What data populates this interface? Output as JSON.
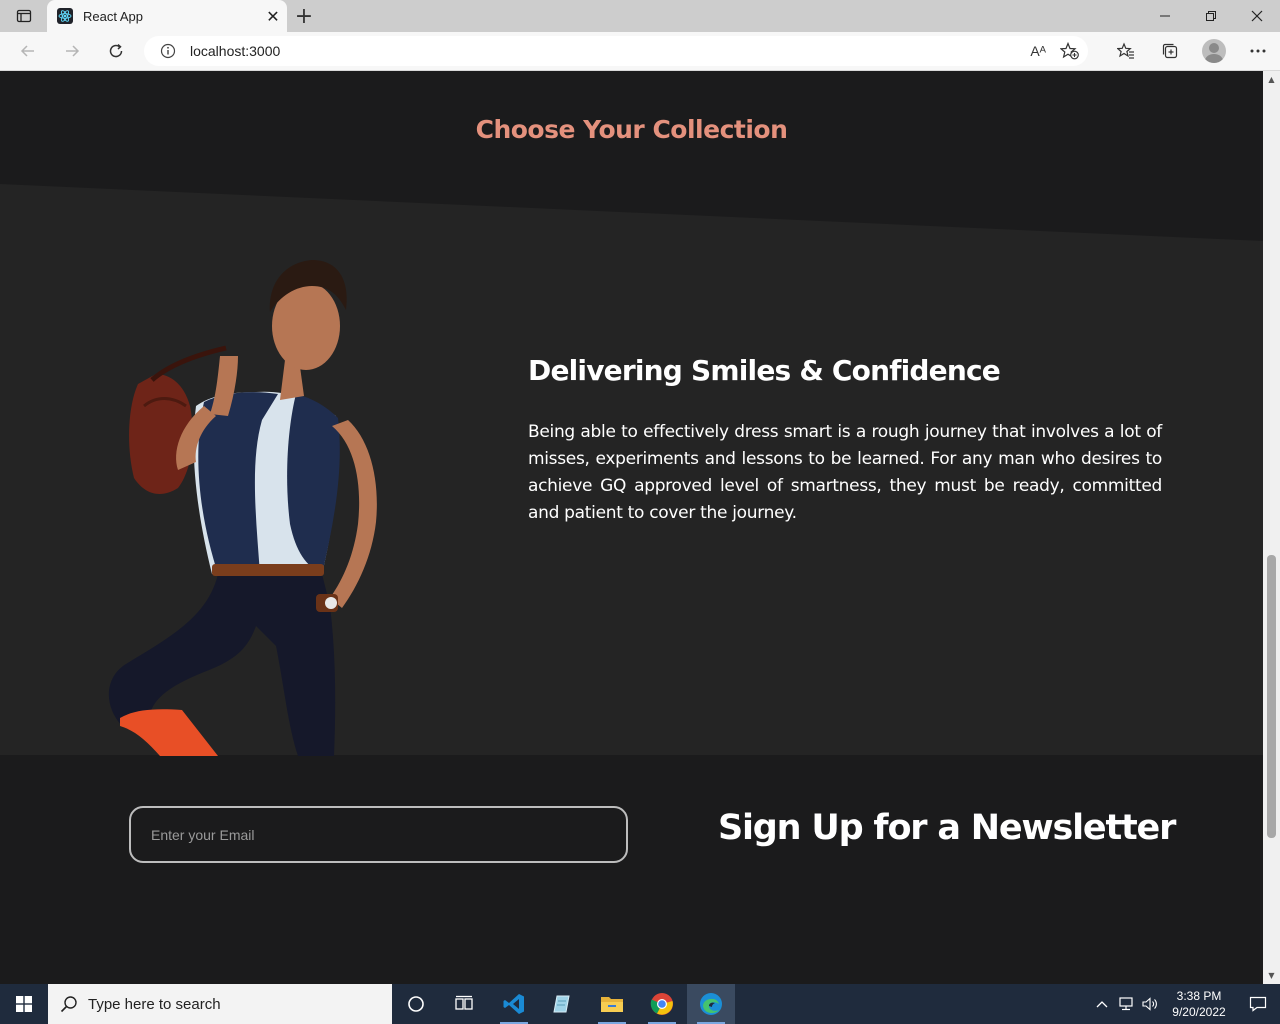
{
  "browser": {
    "tab_title": "React App",
    "url": "localhost:3000",
    "read_aloud_label": "Aᴬ"
  },
  "page": {
    "collection_heading": "Choose Your Collection",
    "feature": {
      "title": "Delivering Smiles & Confidence",
      "body": "Being able to effectively dress smart is a rough journey that involves a lot of misses, experiments and lessons to be learned. For any man who desires to achieve GQ approved level of smartness, they must be ready, committed and patient to cover the journey."
    },
    "newsletter": {
      "placeholder": "Enter your Email",
      "title": "Sign Up for a Newsletter"
    }
  },
  "taskbar": {
    "search_placeholder": "Type here to search",
    "time": "3:38 PM",
    "date": "9/20/2022"
  },
  "colors": {
    "accent": "#e4917d",
    "page_bg": "#1b1b1c",
    "section_bg": "#242424"
  }
}
